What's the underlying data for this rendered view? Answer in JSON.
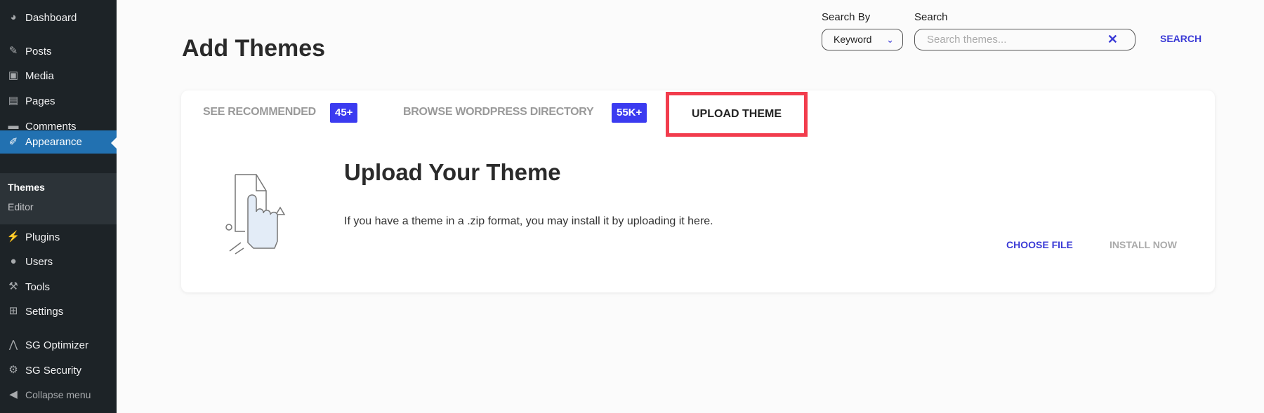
{
  "sidebar": {
    "items": [
      {
        "label": "Dashboard",
        "icon": "dashboard-icon"
      },
      {
        "label": "Posts",
        "icon": "pin-icon"
      },
      {
        "label": "Media",
        "icon": "media-icon"
      },
      {
        "label": "Pages",
        "icon": "pages-icon"
      },
      {
        "label": "Comments",
        "icon": "comment-icon"
      },
      {
        "label": "Appearance",
        "icon": "brush-icon"
      },
      {
        "label": "Plugins",
        "icon": "plug-icon"
      },
      {
        "label": "Users",
        "icon": "user-icon"
      },
      {
        "label": "Tools",
        "icon": "wrench-icon"
      },
      {
        "label": "Settings",
        "icon": "settings-icon"
      },
      {
        "label": "SG Optimizer",
        "icon": "sg-optimizer-icon"
      },
      {
        "label": "SG Security",
        "icon": "sg-security-icon"
      },
      {
        "label": "Collapse menu",
        "icon": "collapse-icon"
      }
    ],
    "submenu": [
      {
        "label": "Themes"
      },
      {
        "label": "Editor"
      }
    ]
  },
  "header": {
    "title": "Add Themes",
    "search_by_label": "Search By",
    "search_by_value": "Keyword",
    "search_label": "Search",
    "search_placeholder": "Search themes...",
    "search_button": "SEARCH"
  },
  "tabs": [
    {
      "label": "SEE RECOMMENDED",
      "badge": "45+"
    },
    {
      "label": "BROWSE WORDPRESS DIRECTORY",
      "badge": "55K+"
    },
    {
      "label": "UPLOAD THEME",
      "active": true
    }
  ],
  "upload": {
    "title": "Upload Your Theme",
    "description": "If you have a theme in a .zip format, you may install it by uploading it here.",
    "choose_file": "CHOOSE FILE",
    "install_now": "INSTALL NOW"
  },
  "colors": {
    "accent": "#3b3bf0",
    "highlight": "#f23c4d",
    "sidebar": "#1d2327",
    "active_menu": "#2271b1"
  }
}
